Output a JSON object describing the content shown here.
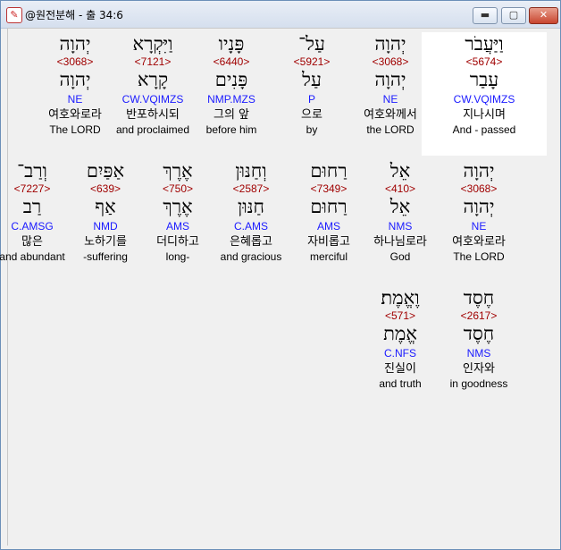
{
  "window": {
    "title": "@원전분해 - 출 34:6",
    "minimize_glyph": "▬",
    "maximize_glyph": "▢",
    "close_glyph": "✕",
    "app_icon_glyph": "✎"
  },
  "rows": [
    [
      {
        "heb": "וַיַּעֲבֹר",
        "strong": "<5674>",
        "lemma": "עָבַר",
        "morph": "CW.VQIMZS",
        "kor": "지나시며",
        "eng": "And - passed",
        "selected": true
      },
      {
        "heb": "יְהוָה",
        "strong": "<3068>",
        "lemma": "יְהוָה",
        "morph": "NE",
        "kor": "여호와께서",
        "eng": "the LORD"
      },
      {
        "heb": "עַל־",
        "strong": "<5921>",
        "lemma": "עַל",
        "morph": "P",
        "kor": "으로",
        "eng": "by"
      },
      {
        "heb": "פָּנָיו",
        "strong": "<6440>",
        "lemma": "פָּנִים",
        "morph": "NMP.MZS",
        "kor": "그의 앞",
        "eng": "before him"
      },
      {
        "heb": "וַיִּקְרָא",
        "strong": "<7121>",
        "lemma": "קָרָא",
        "morph": "CW.VQIMZS",
        "kor": "반포하시되",
        "eng": "and proclaimed"
      },
      {
        "heb": "יְהוָה",
        "strong": "<3068>",
        "lemma": "יְהוָה",
        "morph": "NE",
        "kor": "여호와로라",
        "eng": "The LORD"
      }
    ],
    [
      {
        "heb": "יְהוָה",
        "strong": "<3068>",
        "lemma": "יְהוָה",
        "morph": "NE",
        "kor": "여호와로라",
        "eng": "The LORD"
      },
      {
        "heb": "אֵל",
        "strong": "<410>",
        "lemma": "אֵל",
        "morph": "NMS",
        "kor": "하나님로라",
        "eng": "God"
      },
      {
        "heb": "רַחוּם",
        "strong": "<7349>",
        "lemma": "רַחוּם",
        "morph": "AMS",
        "kor": "자비롭고",
        "eng": "merciful"
      },
      {
        "heb": "וְחַנּוּן",
        "strong": "<2587>",
        "lemma": "חַנּוּן",
        "morph": "C.AMS",
        "kor": "은혜롭고",
        "eng": "and gracious"
      },
      {
        "heb": "אֶרֶךְ",
        "strong": "<750>",
        "lemma": "אֶרֶךְ",
        "morph": "AMS",
        "kor": "더디하고",
        "eng": "long-"
      },
      {
        "heb": "אַפַּיִם",
        "strong": "<639>",
        "lemma": "אַף",
        "morph": "NMD",
        "kor": "노하기를",
        "eng": "-suffering"
      },
      {
        "heb": "וְרַב־",
        "strong": "<7227>",
        "lemma": "רַב",
        "morph": "C.AMSG",
        "kor": "많은",
        "eng": "and abundant"
      }
    ],
    [
      {
        "heb": "חֶסֶד",
        "strong": "<2617>",
        "lemma": "חֶסֶד",
        "morph": "NMS",
        "kor": "인자와",
        "eng": "in goodness"
      },
      {
        "heb": "וֶאֱמֶת׃",
        "strong": "<571>",
        "lemma": "אֱמֶת",
        "morph": "C.NFS",
        "kor": "진실이",
        "eng": "and truth"
      }
    ]
  ]
}
